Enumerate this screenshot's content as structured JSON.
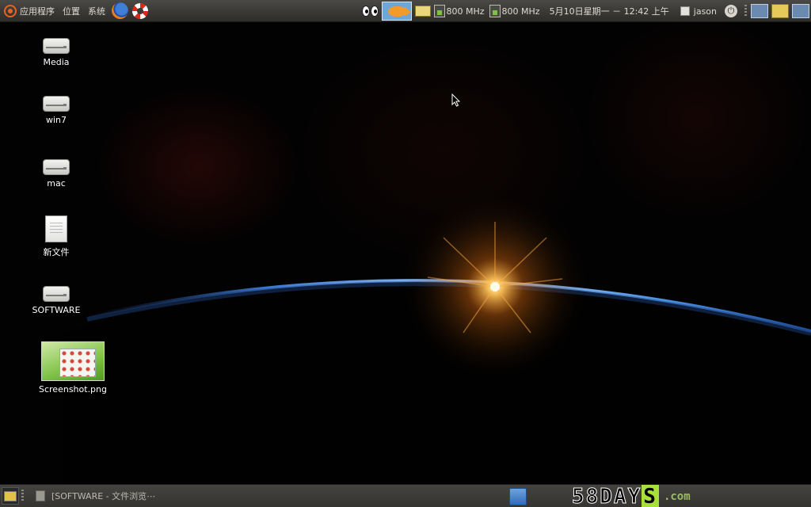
{
  "top_panel": {
    "menus": {
      "applications": "应用程序",
      "places": "位置",
      "system": "系统"
    },
    "launchers": [
      "firefox-icon",
      "help-icon"
    ],
    "tray": {
      "cpu1_freq": "800 MHz",
      "cpu2_freq": "800 MHz",
      "clock": "5月10日星期一 － 12:42 上午",
      "user": "jason"
    }
  },
  "desktop": {
    "icons": [
      {
        "label": "Media",
        "type": "drive"
      },
      {
        "label": "win7",
        "type": "drive"
      },
      {
        "label": "mac",
        "type": "drive"
      },
      {
        "label": "新文件",
        "type": "document"
      },
      {
        "label": "SOFTWARE",
        "type": "drive"
      },
      {
        "label": "Screenshot.png",
        "type": "image"
      }
    ]
  },
  "bottom_panel": {
    "task": "[SOFTWARE - 文件浏览⋯",
    "watermark": {
      "part1": "58DAY",
      "part2": "S",
      "part3": ".com"
    }
  },
  "colors": {
    "panel": "#3a3936",
    "panel_text": "#dfdbd2",
    "horizon_blue": "#4a8fe0",
    "sun": "#ffb040",
    "watermark_green": "#a8e03a"
  }
}
